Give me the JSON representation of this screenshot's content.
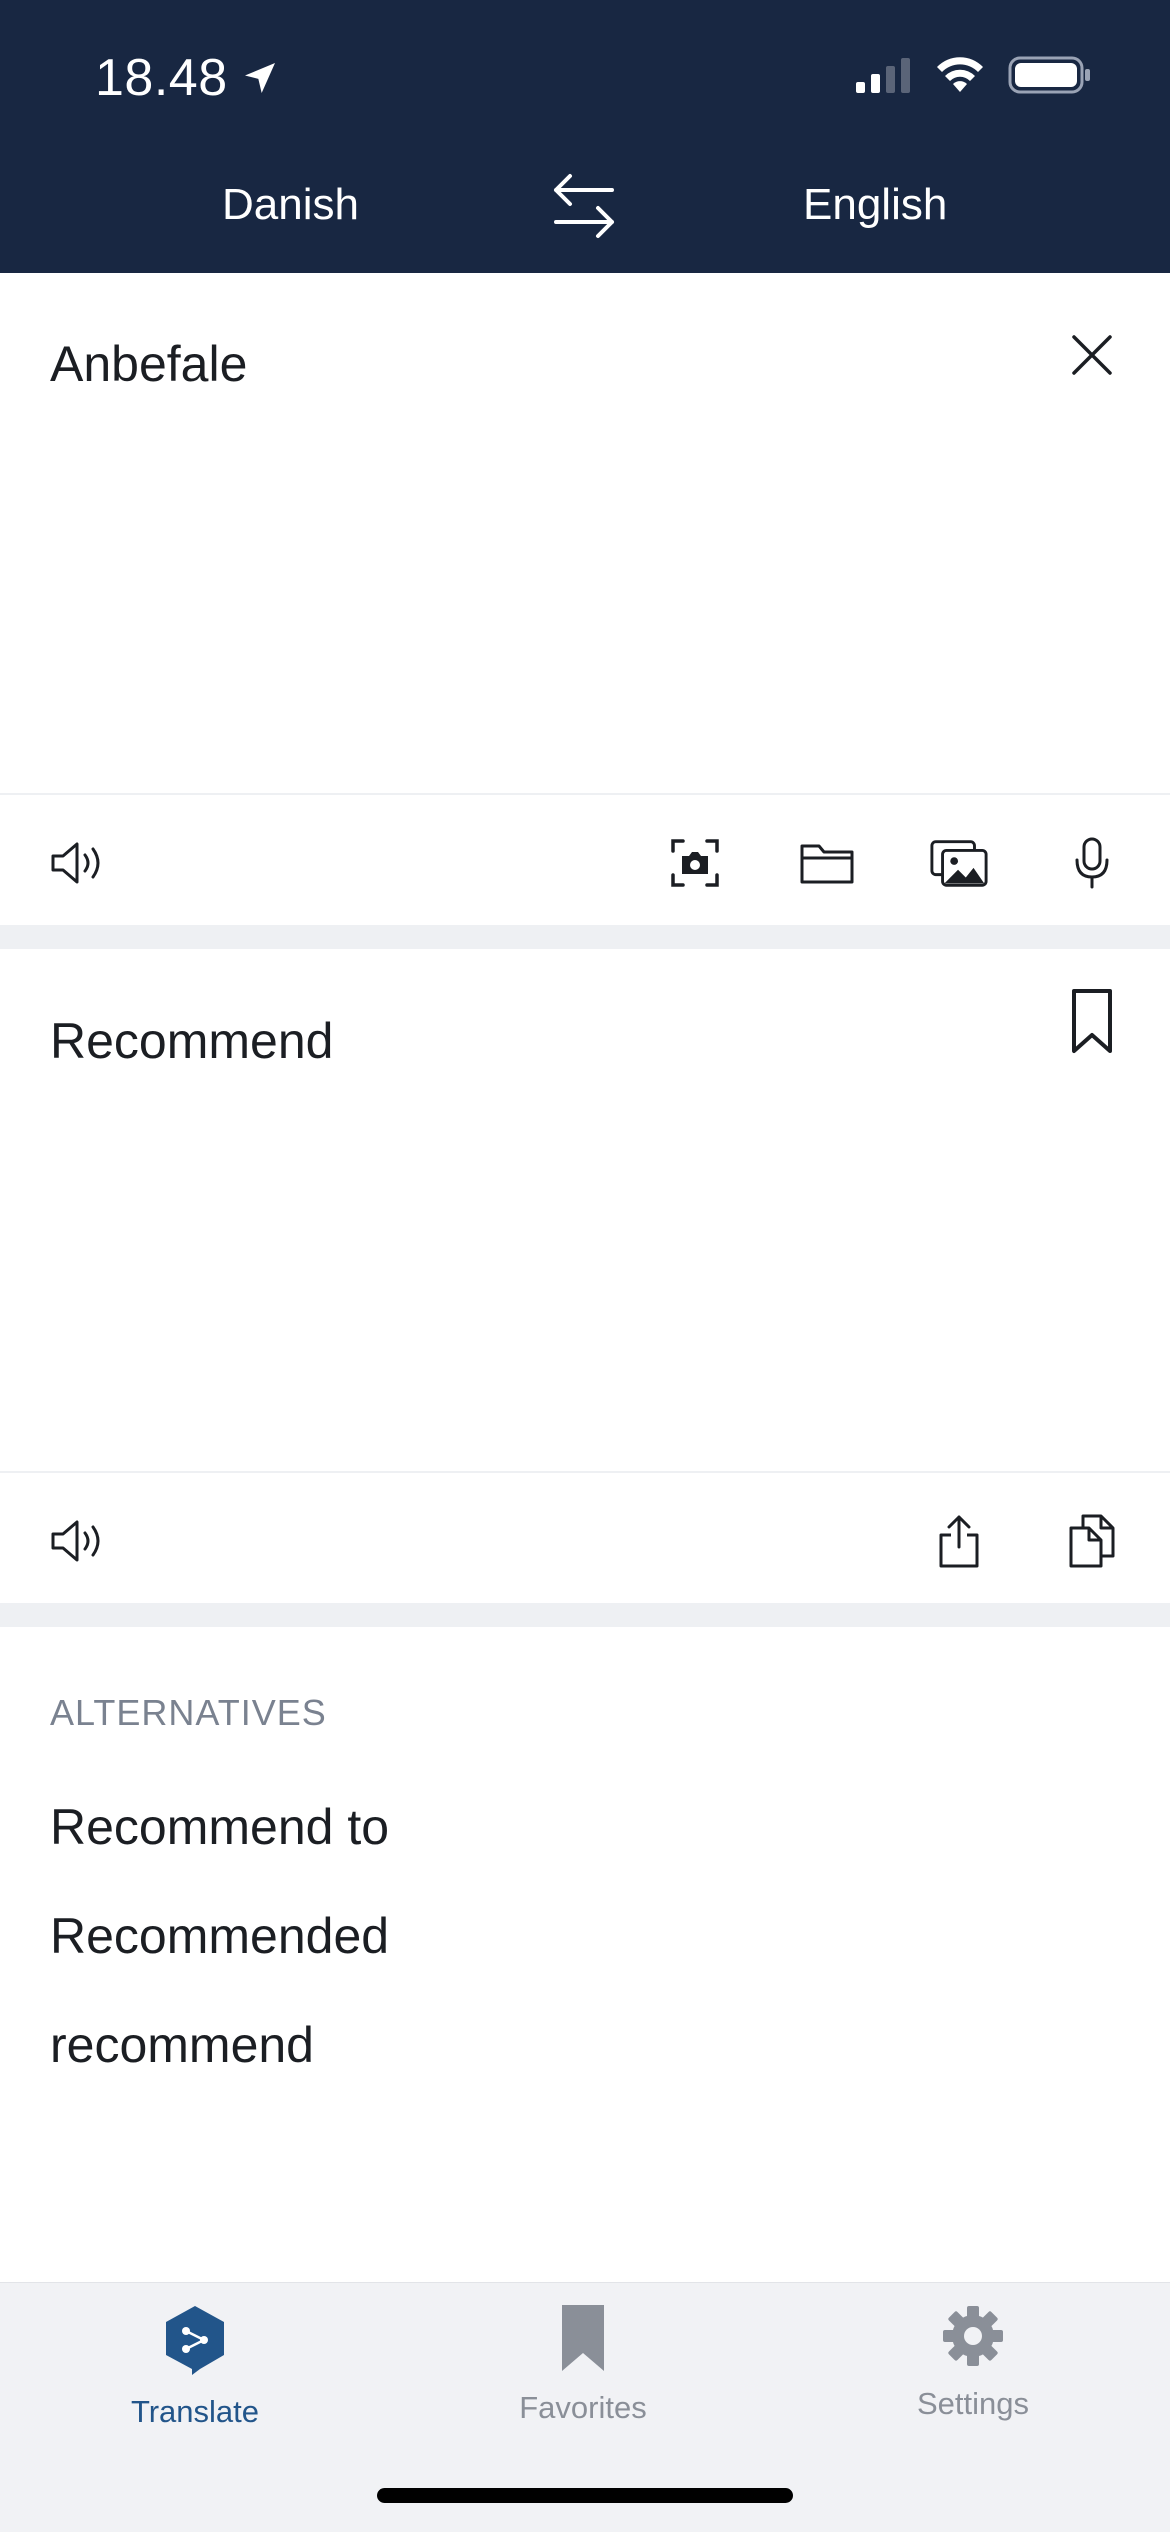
{
  "status_bar": {
    "time": "18.48"
  },
  "header": {
    "source_language": "Danish",
    "target_language": "English"
  },
  "source": {
    "text": "Anbefale"
  },
  "translation": {
    "text": "Recommend"
  },
  "alternatives": {
    "title": "ALTERNATIVES",
    "items": [
      "Recommend to",
      "Recommended",
      "recommend"
    ]
  },
  "tabs": [
    {
      "label": "Translate",
      "icon": "translate-hex-icon",
      "active": true
    },
    {
      "label": "Favorites",
      "icon": "bookmark-icon",
      "active": false
    },
    {
      "label": "Settings",
      "icon": "gear-icon",
      "active": false
    }
  ],
  "colors": {
    "header_bg": "#182742",
    "active_tab": "#22558a",
    "inactive_tab": "#8a8f98",
    "separator": "#eef0f3"
  }
}
